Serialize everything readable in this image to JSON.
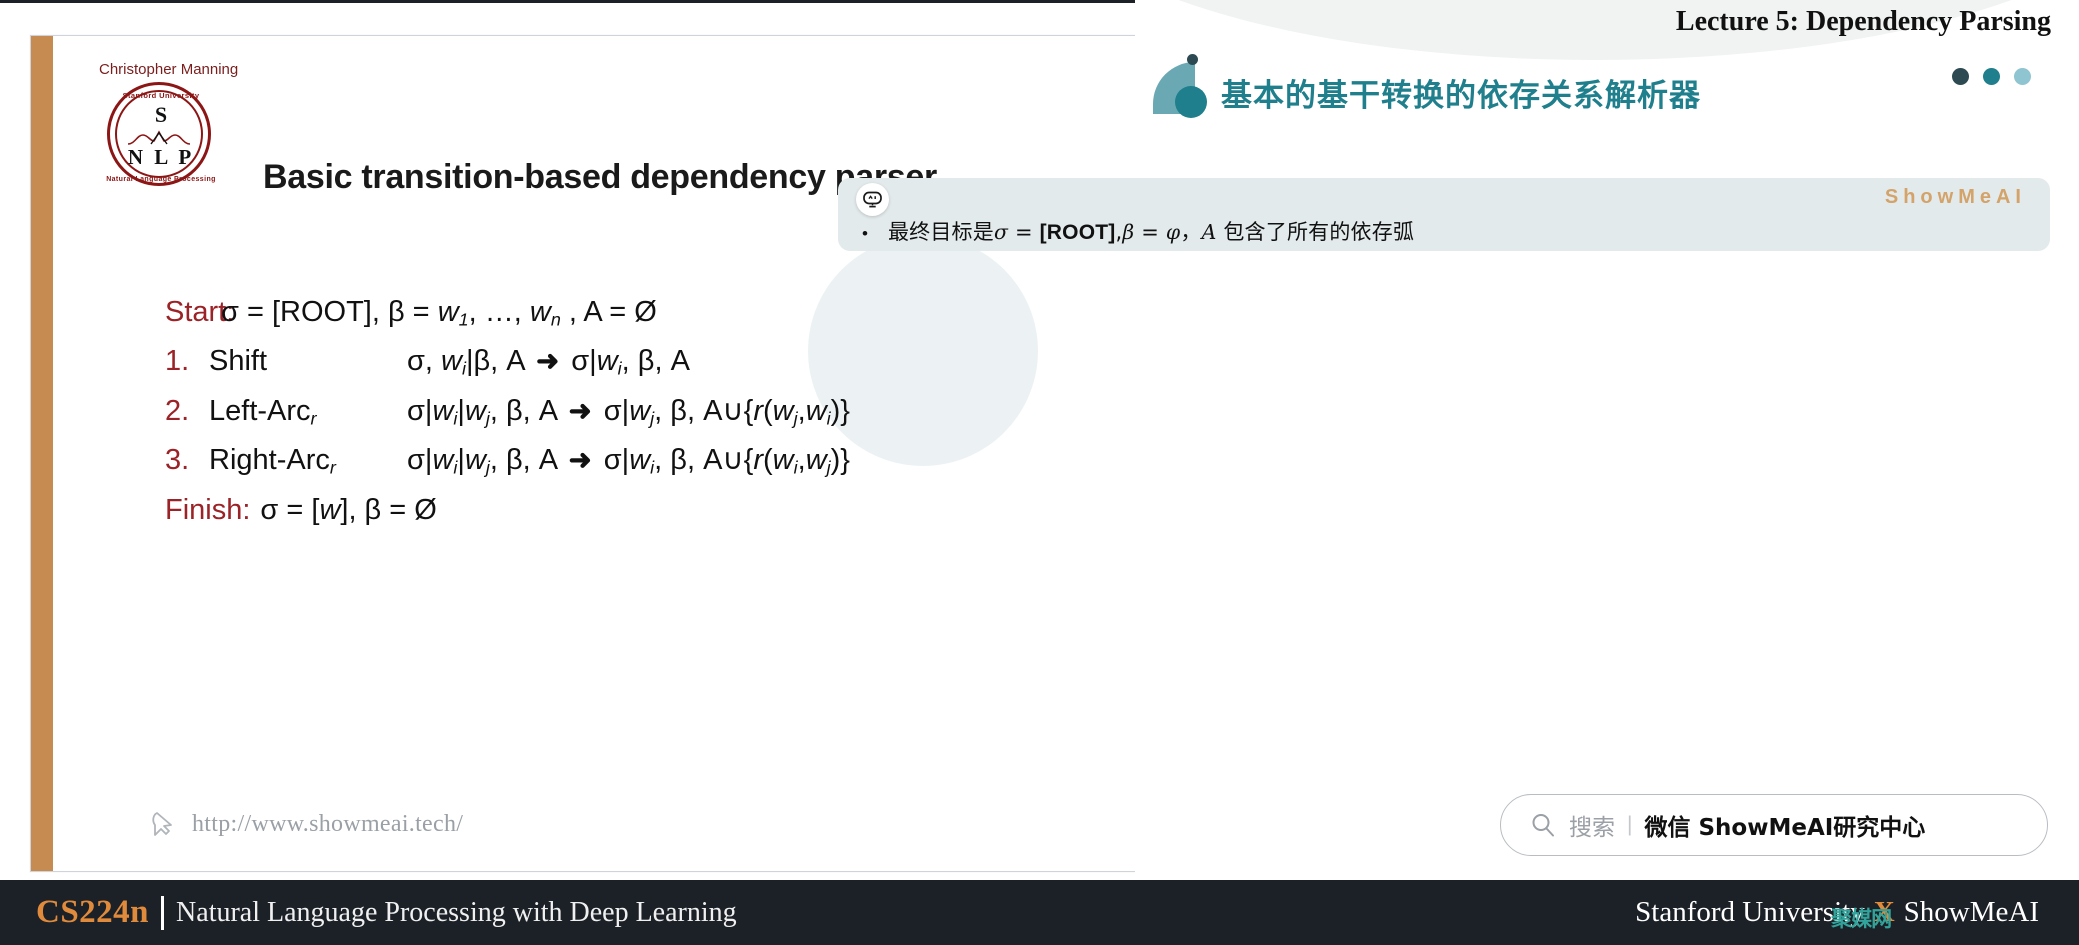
{
  "header": {
    "lecture_title": "Lecture 5:  Dependency Parsing",
    "section_title": "基本的基干转换的依存关系解析器"
  },
  "slide": {
    "author": "Christopher Manning",
    "logo": {
      "arc_top": "Stanford University",
      "center_letter": "S",
      "center_word": "N L P",
      "arc_bottom": "Natural Language Processing"
    },
    "title": "Basic transition-based dependency parser",
    "rows": [
      {
        "label": "Start:",
        "name": "",
        "expr_html": "σ = [ROOT], β = <em class='it'>w</em><sub class='sb'>1</sub>, …, <em class='it'>w</em><sub class='sb'>n</sub> , A = Ø"
      },
      {
        "label": "1.",
        "name": "Shift",
        "expr_html": "σ, <em class='it'>w</em><sub class='sb'>i</sub>|β, A <span class='arrow-glyph'>➜</span> σ|<em class='it'>w</em><sub class='sb'>i</sub>, β, A"
      },
      {
        "label": "2.",
        "name": "Left-Arc<sub class='sb'>r</sub>",
        "expr_html": "σ|<em class='it'>w</em><sub class='sb'>i</sub>|<em class='it'>w</em><sub class='sb'>j</sub>, β, A <span class='arrow-glyph'>➜</span> σ|<em class='it'>w</em><sub class='sb'>j</sub>, β, A∪{<em class='it'>r</em>(<em class='it'>w</em><sub class='sb'>j</sub>,<em class='it'>w</em><sub class='sb'>i</sub>)}"
      },
      {
        "label": "3.",
        "name": "Right-Arc<sub class='sb'>r</sub>",
        "expr_html": "σ|<em class='it'>w</em><sub class='sb'>i</sub>|<em class='it'>w</em><sub class='sb'>j</sub>, β, A <span class='arrow-glyph'>➜</span> σ|<em class='it'>w</em><sub class='sb'>i</sub>, β, A∪{<em class='it'>r</em>(<em class='it'>w</em><sub class='sb'>i</sub>,<em class='it'>w</em><sub class='sb'>j</sub>)}"
      },
      {
        "label": "Finish:",
        "name": "",
        "expr_html": "σ = [<em class='it'>w</em>], β = Ø"
      }
    ],
    "url": "http://www.showmeai.tech/"
  },
  "note": {
    "brand": "ShowMeAI",
    "bullet_marker": "•",
    "text_html": "最终目标是<span class='mathit'>σ</span> = <span class='mathrm'>[ROOT]</span>,<span class='mathit'>β</span> = <span class='mathit'>φ</span>，<span class='mathit'>A</span> 包含了所有的依存弧",
    "ai_icon": "ai-robot-icon"
  },
  "search": {
    "placeholder": "搜索",
    "divider": "|",
    "brand": "微信 ShowMeAI研究中心"
  },
  "footer": {
    "course_code": "CS224n",
    "course_name": "Natural Language Processing with Deep Learning",
    "partner_left": "Stanford University",
    "partner_x": "X",
    "partner_right": "ShowMeAI",
    "watermark": "聚媒网"
  },
  "colors": {
    "accent_orange": "#e08a3c",
    "slide_bar": "#c68b50",
    "teal": "#1f7f8c",
    "teal_light": "#8fc4d1",
    "maroon": "#9b2226",
    "note_bg": "#e3eaec",
    "brand_gold": "#d3a36a",
    "footer_bg": "#1c2128"
  }
}
